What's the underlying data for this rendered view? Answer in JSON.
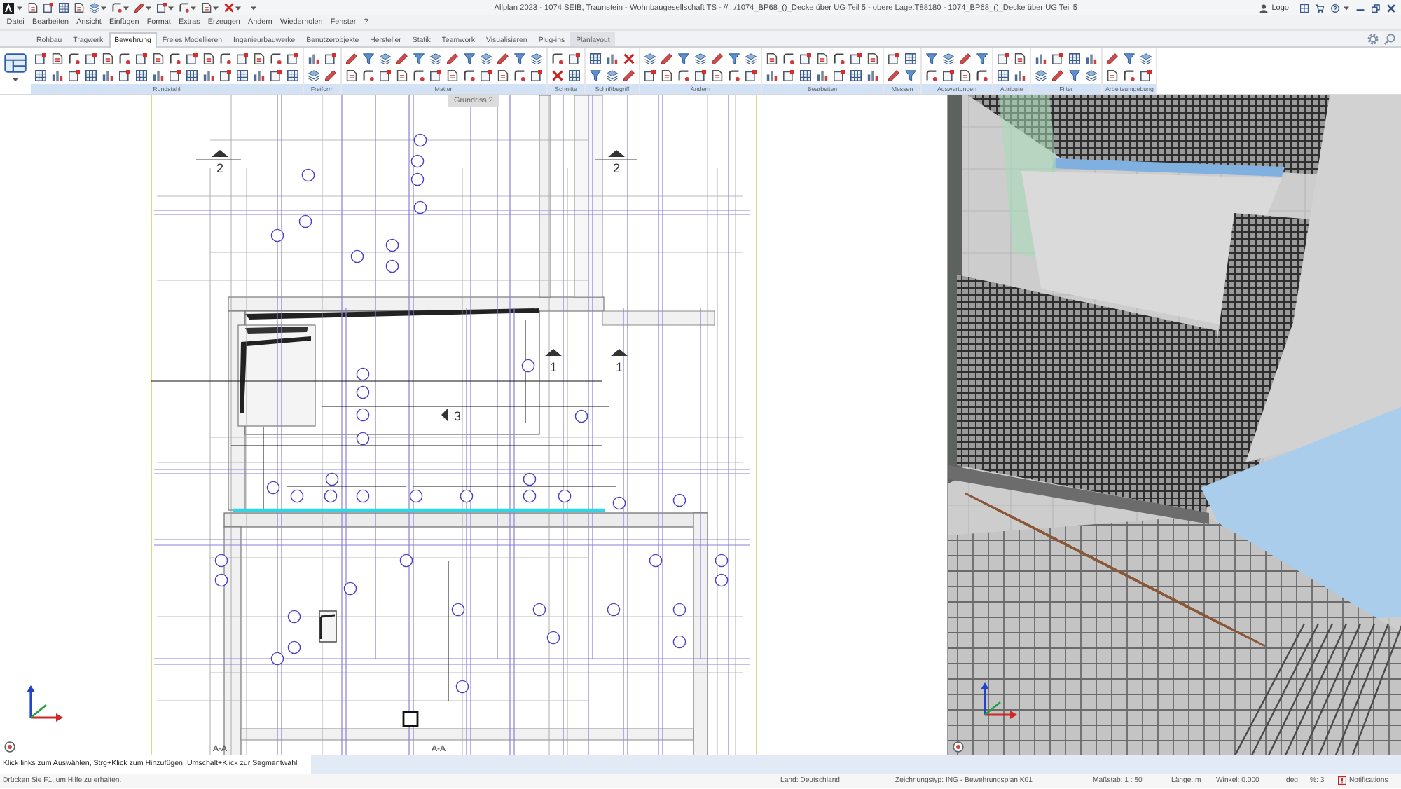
{
  "window": {
    "title": "Allplan 2023 - 1074 SEIB, Traunstein - Wohnbaugesellschaft TS - //.../1074_BP68_()_Decke über UG Teil 5 - obere Lage:T88180 - 1074_BP68_()_Decke über UG Teil 5",
    "user": "Logo"
  },
  "menu": [
    "Datei",
    "Bearbeiten",
    "Ansicht",
    "Einfügen",
    "Format",
    "Extras",
    "Erzeugen",
    "Ändern",
    "Wiederholen",
    "Fenster",
    "?"
  ],
  "ribbon": {
    "tabs": [
      {
        "label": "Rohbau",
        "selected": false,
        "highlighted": false
      },
      {
        "label": "Tragwerk",
        "selected": false,
        "highlighted": false
      },
      {
        "label": "Bewehrung",
        "selected": true,
        "highlighted": false
      },
      {
        "label": "Freies Modellieren",
        "selected": false,
        "highlighted": false
      },
      {
        "label": "Ingenieurbauwerke",
        "selected": false,
        "highlighted": false
      },
      {
        "label": "Benutzerobjekte",
        "selected": false,
        "highlighted": false
      },
      {
        "label": "Hersteller",
        "selected": false,
        "highlighted": false
      },
      {
        "label": "Statik",
        "selected": false,
        "highlighted": false
      },
      {
        "label": "Teamwork",
        "selected": false,
        "highlighted": false
      },
      {
        "label": "Visualisieren",
        "selected": false,
        "highlighted": false
      },
      {
        "label": "Plug-ins",
        "selected": false,
        "highlighted": false
      },
      {
        "label": "Planlayout",
        "selected": false,
        "highlighted": true
      }
    ],
    "groups": [
      "Rundstahl",
      "Freiform",
      "Matten",
      "Schnitte",
      "Schriftbegriff",
      "Ändern",
      "Bearbeiten",
      "Messen",
      "Auswertungen",
      "Attribute",
      "Filter",
      "Arbeitsumgebung"
    ]
  },
  "plan_view": {
    "label": "Grundriss 2",
    "section_marks": [
      "2",
      "2",
      "1",
      "1",
      "3",
      "A-A",
      "A-A"
    ]
  },
  "prompt": "Klick links zum Auswählen, Strg+Klick zum Hinzufügen, Umschalt+Klick zur Segmentwahl",
  "status_bar": {
    "help": "Drücken Sie F1, um Hilfe zu erhalten.",
    "fields": [
      "Land: Deutschland",
      "Zeichnungstyp: ING - Bewehrungsplan K01",
      "Maßstab: 1 : 50",
      "Länge: m",
      "Winkel: 0.000",
      "deg",
      "%: 3"
    ],
    "notifications": "Notifications"
  }
}
